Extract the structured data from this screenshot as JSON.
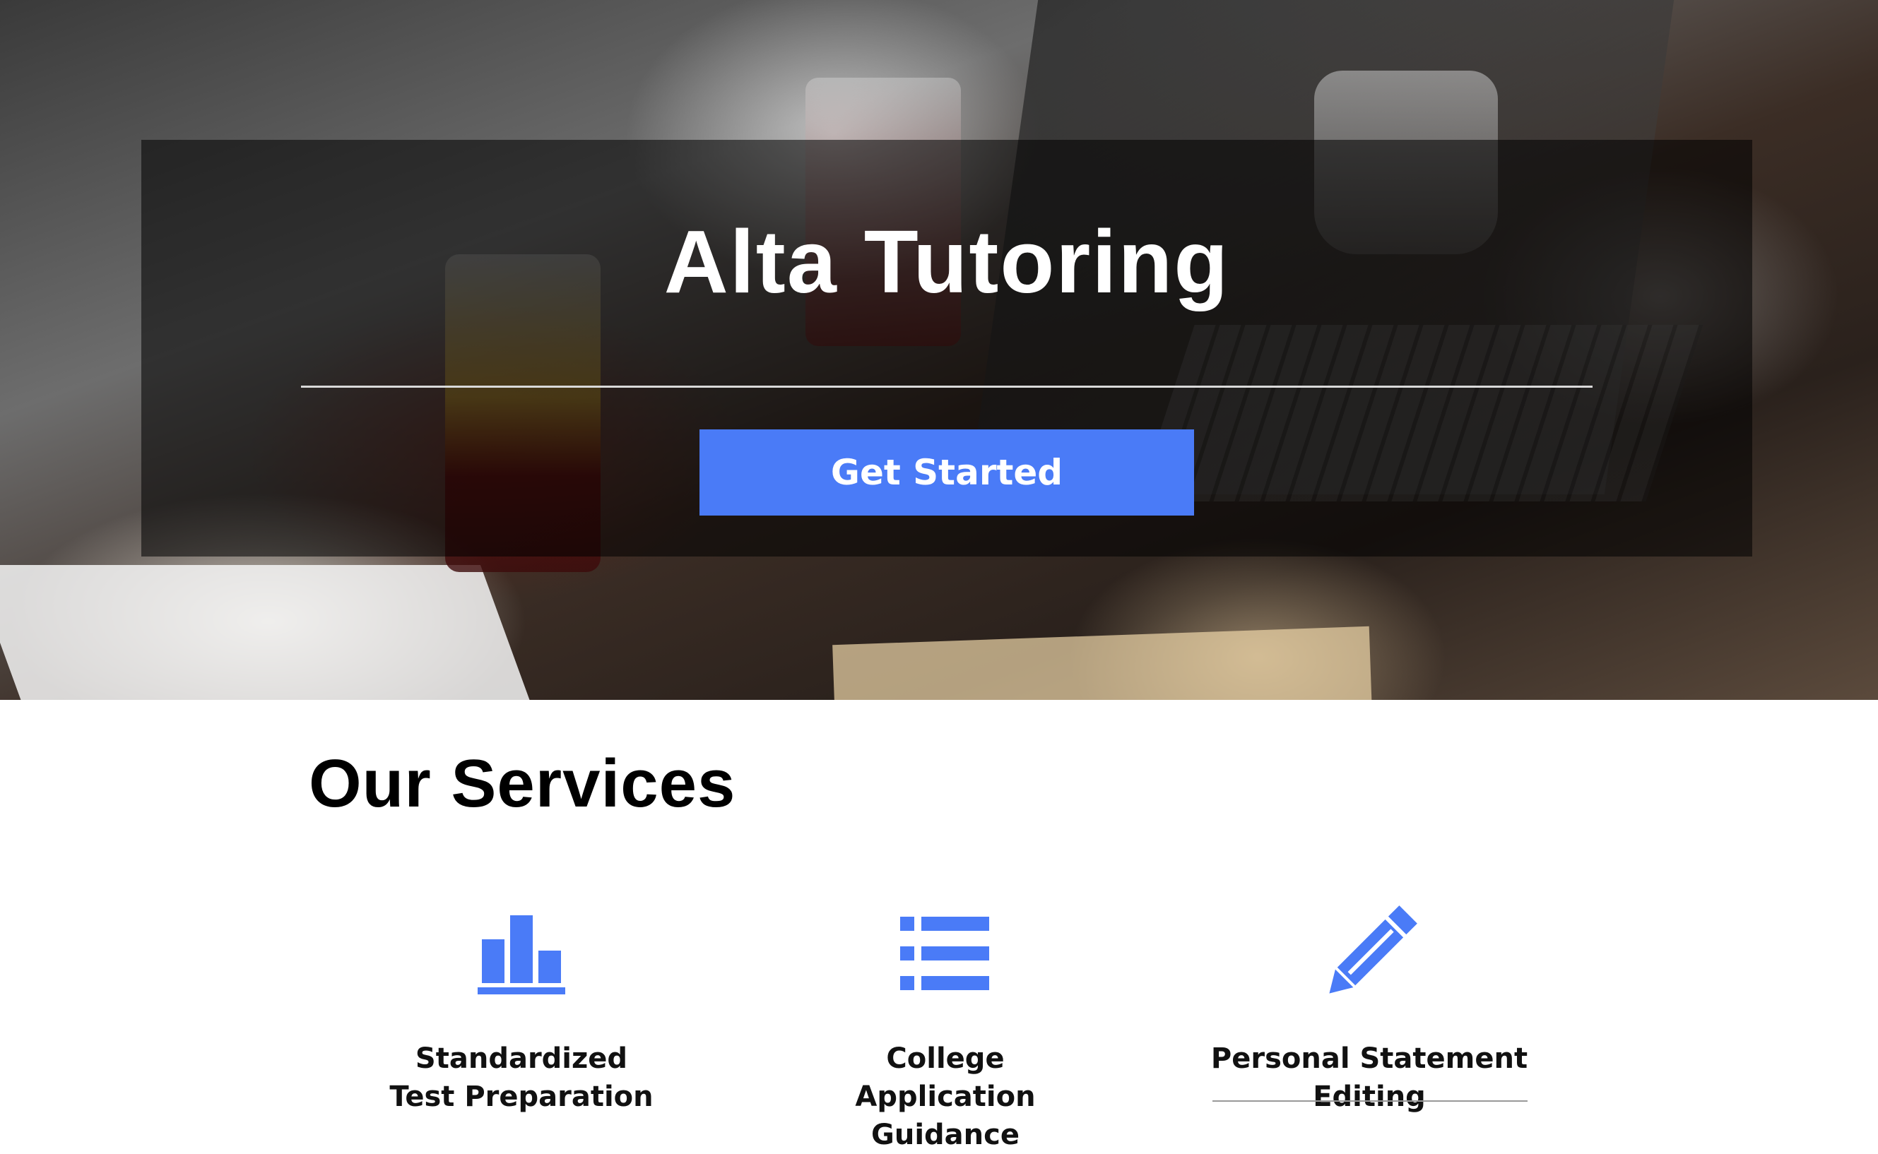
{
  "hero": {
    "title": "Alta Tutoring",
    "cta_label": "Get Started"
  },
  "services": {
    "heading": "Our Services",
    "items": [
      {
        "label": "Standardized Test Preparation",
        "icon": "bar-chart-icon"
      },
      {
        "label": "College Application Guidance",
        "icon": "list-icon"
      },
      {
        "label": "Personal Statement Editing",
        "icon": "pencil-icon"
      }
    ]
  },
  "colors": {
    "accent": "#4a7bf7",
    "overlay": "rgba(0,0,0,0.55)",
    "text_dark": "#111111"
  }
}
